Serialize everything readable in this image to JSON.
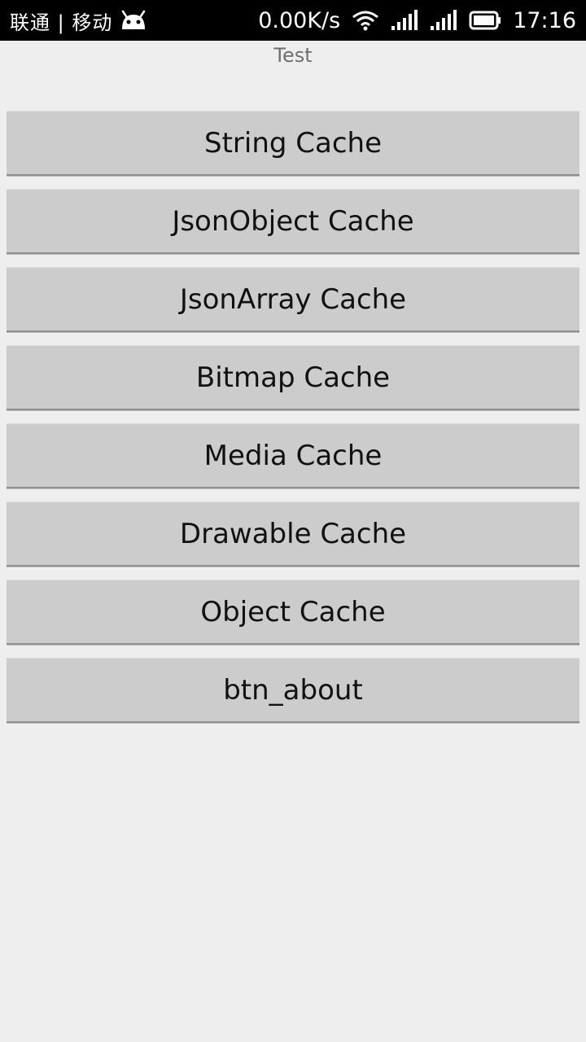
{
  "status_bar": {
    "carrier": "联通 | 移动",
    "net_speed": "0.00K/s",
    "time": "17:16",
    "icons": [
      "android-icon",
      "wifi-icon",
      "signal-icon",
      "signal-icon",
      "battery-icon"
    ]
  },
  "header": {
    "title": "Test"
  },
  "buttons": [
    {
      "label": "String Cache"
    },
    {
      "label": "JsonObject Cache"
    },
    {
      "label": "JsonArray Cache"
    },
    {
      "label": "Bitmap Cache"
    },
    {
      "label": "Media Cache"
    },
    {
      "label": "Drawable Cache"
    },
    {
      "label": "Object Cache"
    },
    {
      "label": "btn_about"
    }
  ],
  "colors": {
    "status_bar_bg": "#000000",
    "page_bg": "#eeeeee",
    "button_bg": "#cccccc",
    "title_text": "#6f6f6f"
  }
}
